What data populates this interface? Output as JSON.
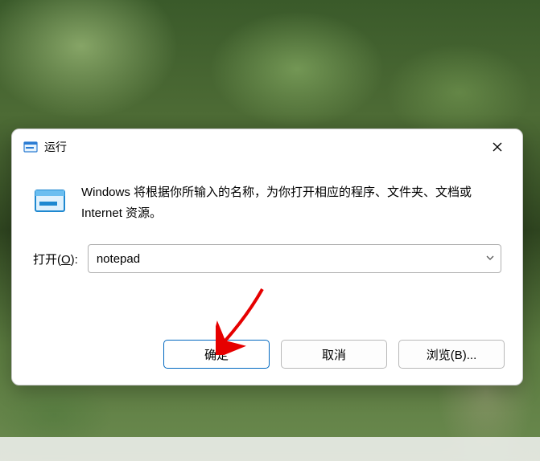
{
  "dialog": {
    "title": "运行",
    "description": "Windows 将根据你所输入的名称，为你打开相应的程序、文件夹、文档或 Internet 资源。",
    "open_label_prefix": "打开(",
    "open_label_key": "O",
    "open_label_suffix": "):",
    "input_value": "notepad",
    "buttons": {
      "ok": "确定",
      "cancel": "取消",
      "browse": "浏览(B)..."
    }
  }
}
